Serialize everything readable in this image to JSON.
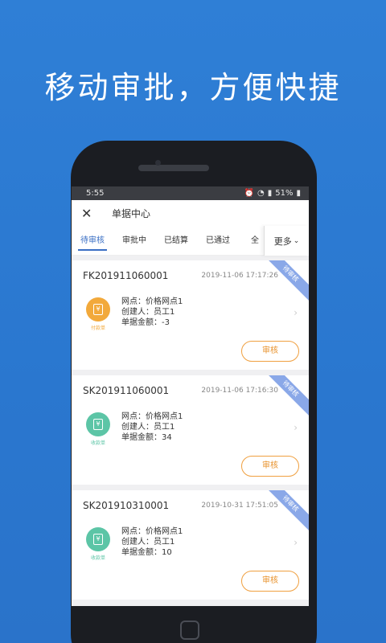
{
  "headline": "移动审批，方便快捷",
  "status_bar": {
    "time": "5:55",
    "battery": "51%"
  },
  "navbar": {
    "title": "单据中心"
  },
  "tabs": [
    {
      "label": "待审核",
      "active": true
    },
    {
      "label": "审批中",
      "active": false
    },
    {
      "label": "已结算",
      "active": false
    },
    {
      "label": "已通过",
      "active": false
    },
    {
      "label": "全",
      "active": false
    }
  ],
  "more_label": "更多",
  "cards": [
    {
      "number": "FK201911060001",
      "time": "2019-11-06 17:17:26",
      "ribbon": "待审核",
      "icon_color": "#f2a93b",
      "icon_caption": "付款单",
      "outlet": "网点：价格网点1",
      "creator": "创建人：员工1",
      "amount": "单据金额：-3",
      "action": "审核"
    },
    {
      "number": "SK201911060001",
      "time": "2019-11-06 17:16:30",
      "ribbon": "待审核",
      "icon_color": "#5cc5a6",
      "icon_caption": "收款单",
      "outlet": "网点：价格网点1",
      "creator": "创建人：员工1",
      "amount": "单据金额：34",
      "action": "审核"
    },
    {
      "number": "SK201910310001",
      "time": "2019-10-31 17:51:05",
      "ribbon": "待审核",
      "icon_color": "#5cc5a6",
      "icon_caption": "收款单",
      "outlet": "网点：价格网点1",
      "creator": "创建人：员工1",
      "amount": "单据金额：10",
      "action": "审核"
    }
  ]
}
